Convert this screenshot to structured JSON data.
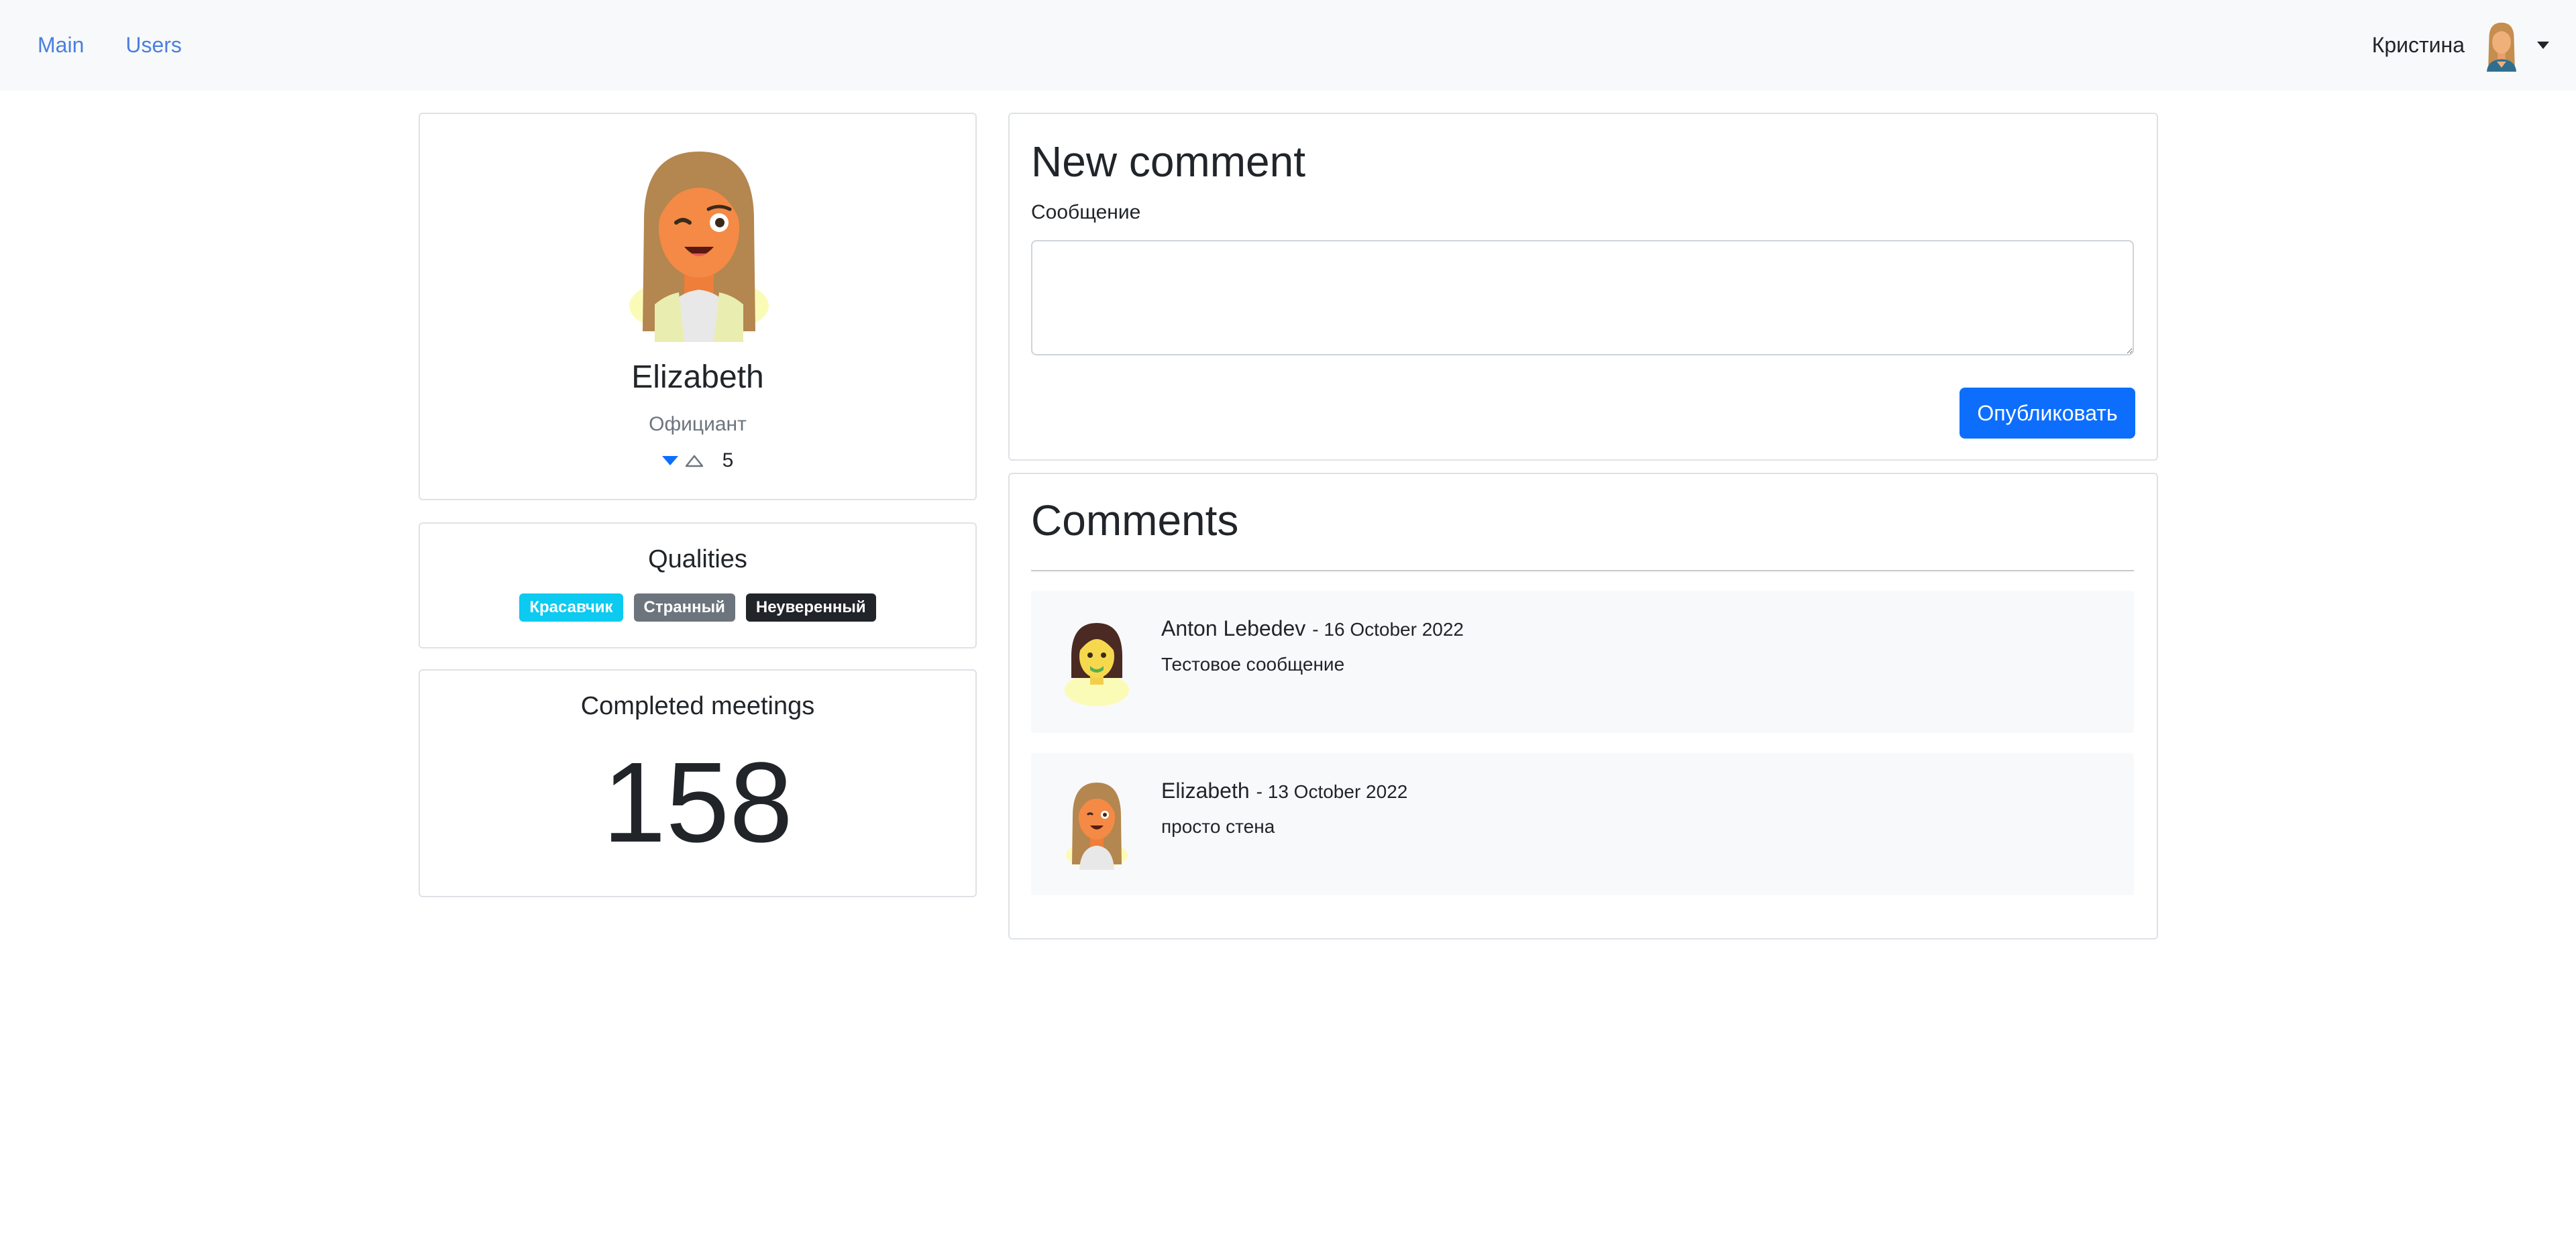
{
  "navbar": {
    "links": [
      "Main",
      "Users"
    ],
    "user_name": "Кристина"
  },
  "profile": {
    "name": "Elizabeth",
    "role": "Официант",
    "rating": "5"
  },
  "qualities": {
    "title": "Qualities",
    "badges": [
      {
        "label": "Красавчик",
        "color": "#0dcaf0"
      },
      {
        "label": "Странный",
        "color": "#6c757d"
      },
      {
        "label": "Неуверенный",
        "color": "#212529"
      }
    ]
  },
  "meetings": {
    "title": "Completed meetings",
    "value": "158"
  },
  "new_comment": {
    "title": "New comment",
    "label": "Сообщение",
    "message_value": "",
    "publish_label": "Опубликовать"
  },
  "comments": {
    "title": "Comments",
    "items": [
      {
        "author": "Anton Lebedev",
        "date": "- 16 October 2022",
        "text": "Тестовое сообщение"
      },
      {
        "author": "Elizabeth",
        "date": "- 13 October 2022",
        "text": "просто стена"
      }
    ]
  },
  "colors": {
    "primary": "#0d6efd",
    "link": "#4a7fe0",
    "navbar_bg": "#f8f9fa",
    "muted": "#6c757d"
  }
}
